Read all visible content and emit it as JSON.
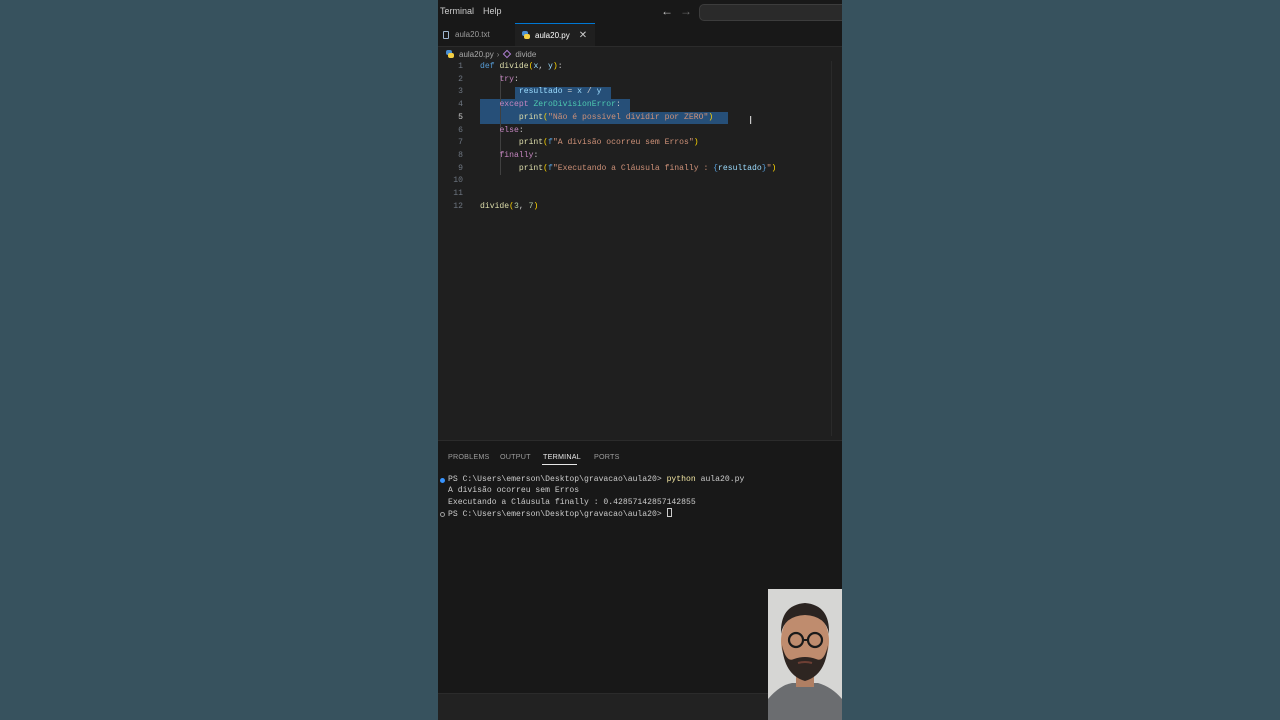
{
  "menu": {
    "items": [
      "Terminal",
      "Help"
    ],
    "back_icon": "←",
    "forward_icon": "→"
  },
  "tabs": [
    {
      "label": "aula20.txt",
      "icon": "file-text-icon",
      "active": false
    },
    {
      "label": "aula20.py",
      "icon": "python-icon",
      "active": true,
      "close_icon": "✕"
    }
  ],
  "breadcrumb": {
    "file": "aula20.py",
    "separator": "›",
    "symbol": "divide"
  },
  "editor": {
    "active_line": 5,
    "lines": [
      {
        "number": "1",
        "tokens": [
          {
            "t": "def",
            "c": "tk-kw"
          },
          {
            "t": " ",
            "c": ""
          },
          {
            "t": "divide",
            "c": "tk-fn"
          },
          {
            "t": "(",
            "c": "tk-br"
          },
          {
            "t": "x",
            "c": "tk-param"
          },
          {
            "t": ", ",
            "c": ""
          },
          {
            "t": "y",
            "c": "tk-param"
          },
          {
            "t": ")",
            "c": "tk-br"
          },
          {
            "t": ":",
            "c": ""
          }
        ]
      },
      {
        "number": "2",
        "tokens": [
          {
            "t": "    ",
            "c": ""
          },
          {
            "t": "try",
            "c": "tk-ctl"
          },
          {
            "t": ":",
            "c": ""
          }
        ]
      },
      {
        "number": "3",
        "tokens": [
          {
            "t": "        ",
            "c": ""
          },
          {
            "t": "resultado",
            "c": "tk-param"
          },
          {
            "t": " = ",
            "c": ""
          },
          {
            "t": "x",
            "c": "tk-param"
          },
          {
            "t": " / ",
            "c": ""
          },
          {
            "t": "y",
            "c": "tk-param"
          }
        ]
      },
      {
        "number": "4",
        "tokens": [
          {
            "t": "    ",
            "c": ""
          },
          {
            "t": "except",
            "c": "tk-ctl"
          },
          {
            "t": " ",
            "c": ""
          },
          {
            "t": "ZeroDivisionError",
            "c": "tk-cls"
          },
          {
            "t": ":",
            "c": ""
          }
        ]
      },
      {
        "number": "5",
        "tokens": [
          {
            "t": "        ",
            "c": ""
          },
          {
            "t": "print",
            "c": "tk-fn"
          },
          {
            "t": "(",
            "c": "tk-br"
          },
          {
            "t": "\"Não é possivel dividir por ZERO\"",
            "c": "tk-str"
          },
          {
            "t": ")",
            "c": "tk-br"
          }
        ]
      },
      {
        "number": "6",
        "tokens": [
          {
            "t": "    ",
            "c": ""
          },
          {
            "t": "else",
            "c": "tk-ctl"
          },
          {
            "t": ":",
            "c": ""
          }
        ]
      },
      {
        "number": "7",
        "tokens": [
          {
            "t": "        ",
            "c": ""
          },
          {
            "t": "print",
            "c": "tk-fn"
          },
          {
            "t": "(",
            "c": "tk-br"
          },
          {
            "t": "f",
            "c": "tk-kw"
          },
          {
            "t": "\"A divisão ocorreu sem Erros\"",
            "c": "tk-str"
          },
          {
            "t": ")",
            "c": "tk-br"
          }
        ]
      },
      {
        "number": "8",
        "tokens": [
          {
            "t": "    ",
            "c": ""
          },
          {
            "t": "finally",
            "c": "tk-ctl"
          },
          {
            "t": ":",
            "c": ""
          }
        ]
      },
      {
        "number": "9",
        "tokens": [
          {
            "t": "        ",
            "c": ""
          },
          {
            "t": "print",
            "c": "tk-fn"
          },
          {
            "t": "(",
            "c": "tk-br"
          },
          {
            "t": "f",
            "c": "tk-kw"
          },
          {
            "t": "\"Executando a Cláusula finally : ",
            "c": "tk-str"
          },
          {
            "t": "{",
            "c": "tk-brace"
          },
          {
            "t": "resultado",
            "c": "tk-param"
          },
          {
            "t": "}",
            "c": "tk-brace"
          },
          {
            "t": "\"",
            "c": "tk-str"
          },
          {
            "t": ")",
            "c": "tk-br"
          }
        ]
      },
      {
        "number": "10",
        "tokens": []
      },
      {
        "number": "11",
        "tokens": []
      },
      {
        "number": "12",
        "tokens": [
          {
            "t": "divide",
            "c": "tk-fn"
          },
          {
            "t": "(",
            "c": "tk-br"
          },
          {
            "t": "3",
            "c": "tk-num"
          },
          {
            "t": ", ",
            "c": ""
          },
          {
            "t": "7",
            "c": "tk-num"
          },
          {
            "t": ")",
            "c": "tk-br"
          }
        ]
      }
    ]
  },
  "panel": {
    "tabs": [
      "PROBLEMS",
      "OUTPUT",
      "TERMINAL",
      "PORTS"
    ],
    "active_tab": "TERMINAL"
  },
  "terminal": {
    "prompt": "PS C:\\Users\\emerson\\Desktop\\gravacao\\aula20> ",
    "command_word": "python",
    "command_args": " aula20.py",
    "output": [
      "A divisão ocorreu sem Erros",
      "Executando a Cláusula finally : 0.42857142857142855"
    ],
    "prompt2": "PS C:\\Users\\emerson\\Desktop\\gravacao\\aula20> "
  },
  "colors": {
    "background": "#37525e",
    "editor_bg": "#1f1f1f",
    "selection": "#264f78",
    "accent": "#0078d4"
  }
}
